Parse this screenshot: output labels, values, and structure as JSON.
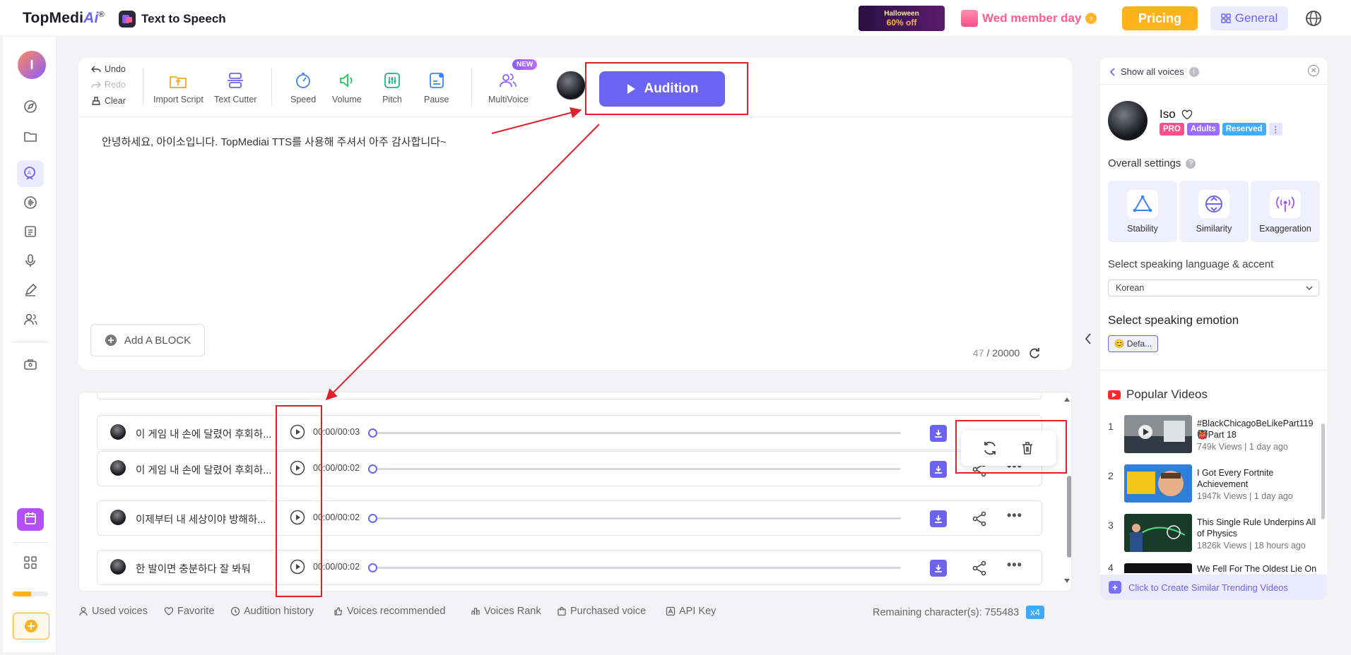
{
  "header": {
    "brand_main": "TopMedi",
    "brand_ai": "Ai",
    "brand_reg": "®",
    "product": "Text to Speech",
    "halloween_title": "Halloween",
    "halloween_offer": "60% off",
    "wed_member": "Wed member day",
    "pricing": "Pricing",
    "general": "General"
  },
  "user": {
    "initial": "I"
  },
  "editor": {
    "undo": "Undo",
    "redo": "Redo",
    "clear": "Clear",
    "tools": [
      {
        "label": "Import Script",
        "icon": "import-script-icon"
      },
      {
        "label": "Text Cutter",
        "icon": "text-cutter-icon"
      },
      {
        "label": "Speed",
        "icon": "speed-icon"
      },
      {
        "label": "Volume",
        "icon": "volume-icon"
      },
      {
        "label": "Pitch",
        "icon": "pitch-icon"
      },
      {
        "label": "Pause",
        "icon": "pause-icon"
      },
      {
        "label": "MultiVoice",
        "icon": "multivoice-icon"
      }
    ],
    "new_badge": "NEW",
    "audition": "Audition",
    "text": "안녕하세요, 아이소입니다. TopMediai TTS를 사용해 주셔서 아주 감사합니다~",
    "add_block": "Add A BLOCK",
    "char_current": "47",
    "char_sep": " / ",
    "char_max": "20000"
  },
  "results": [
    {
      "text": "이 게임 내 손에 달렸어 후회하...",
      "time": "00:00/00:03"
    },
    {
      "text": "이 게임 내 손에 달렸어 후회하...",
      "time": "00:00/00:02"
    },
    {
      "text": "이제부터 내 세상이야 방해하...",
      "time": "00:00/00:02"
    },
    {
      "text": "한 발이면 충분하다 잘 봐둬",
      "time": "00:00/00:02"
    }
  ],
  "bottom": {
    "used_voices": "Used voices",
    "favorite": "Favorite",
    "audition_history": "Audition history",
    "voices_recommended": "Voices recommended",
    "voices_rank": "Voices Rank",
    "purchased_voice": "Purchased voice",
    "api_key": "API Key",
    "remaining": "Remaining character(s): 755483",
    "multiplier": "x4"
  },
  "panel": {
    "show_all": "Show all voices",
    "voice_name": "Iso",
    "tags": [
      "PRO",
      "Adults",
      "Reserved"
    ],
    "overall_settings": "Overall settings",
    "settings": [
      "Stability",
      "Similarity",
      "Exaggeration"
    ],
    "lang_label": "Select speaking language & accent",
    "lang_value": "Korean",
    "emotion_label": "Select speaking emotion",
    "emotion_value": "Defa...",
    "popular_title": "Popular Videos",
    "videos": [
      {
        "num": "1",
        "title": "#BlackChicagoBeLikePart119 👹Part 18",
        "meta": "749k Views | 1 day ago"
      },
      {
        "num": "2",
        "title": "I Got Every Fortnite Achievement",
        "meta": "1947k Views | 1 day ago"
      },
      {
        "num": "3",
        "title": "This Single Rule Underpins All of Physics",
        "meta": "1826k Views | 18 hours ago"
      },
      {
        "num": "4",
        "title": "We Fell For The Oldest Lie On",
        "meta": ""
      }
    ],
    "create_similar": "Click to Create Similar Trending Videos"
  },
  "colors": {
    "accent": "#6b64f2",
    "pricing": "#ffb21c",
    "annotation": "#e0202a"
  }
}
